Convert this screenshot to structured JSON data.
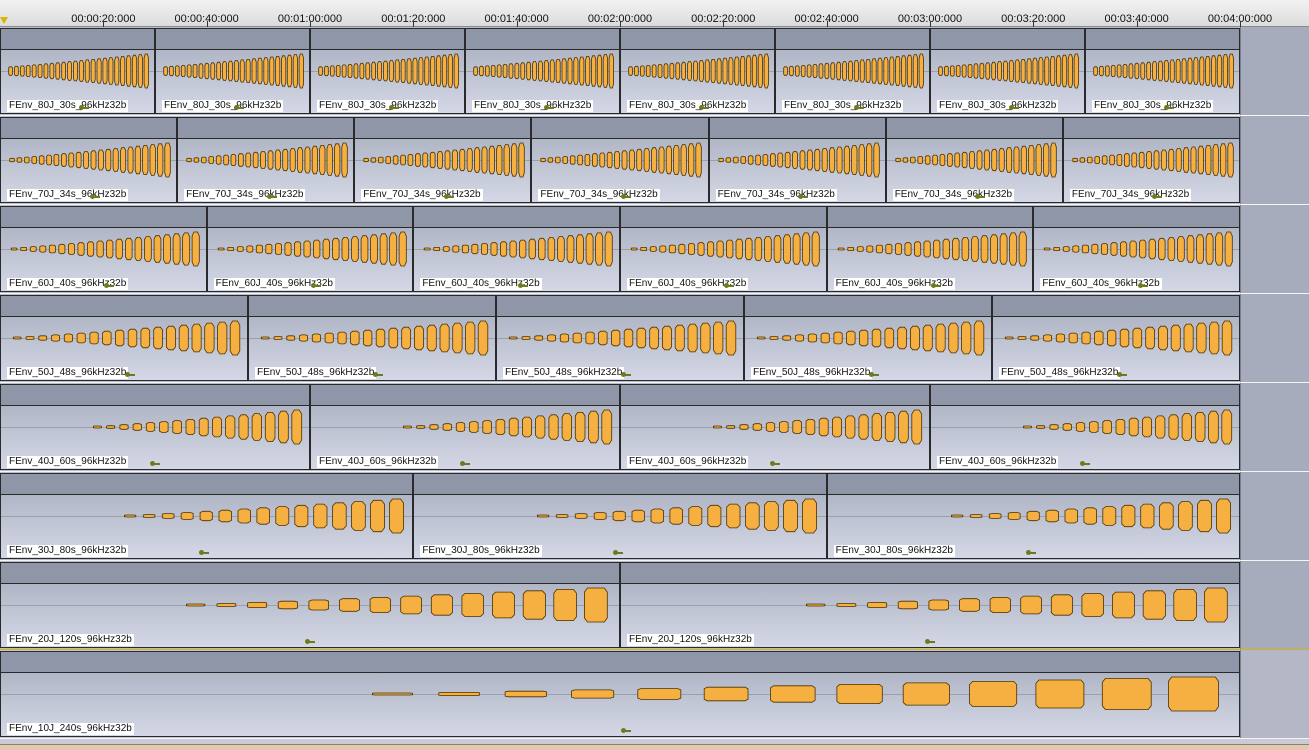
{
  "ruler": {
    "labels": [
      "00:00:20:000",
      "00:00:40:000",
      "00:01:00:000",
      "00:01:20:000",
      "00:01:40:000",
      "00:02:00:000",
      "00:02:20:000",
      "00:02:40:000",
      "00:03:00:000",
      "00:03:20:000",
      "00:03:40:000",
      "00:04:00:000"
    ]
  },
  "tracks": [
    {
      "clip_label": "FEnv_80J_30s_96kHz32b",
      "clip_count": 8,
      "pulses": 24,
      "first_scale": 0.25,
      "min_gap_ratio": 0.25,
      "key_fraction": 0.5
    },
    {
      "clip_label": "FEnv_70J_34s_96kHz32b",
      "clip_count": 7,
      "pulses": 22,
      "first_scale": 0.1,
      "min_gap_ratio": 0.35,
      "key_fraction": 0.5
    },
    {
      "clip_label": "FEnv_60J_40s_96kHz32b",
      "clip_count": 6,
      "pulses": 20,
      "first_scale": 0.06,
      "min_gap_ratio": 0.45,
      "key_fraction": 0.5
    },
    {
      "clip_label": "FEnv_50J_48s_96kHz32b",
      "clip_count": 5,
      "pulses": 18,
      "first_scale": 0.04,
      "min_gap_ratio": 0.55,
      "key_fraction": 0.5
    },
    {
      "clip_label": "FEnv_40J_60s_96kHz32b",
      "clip_count": 4,
      "pulses": 16,
      "first_scale": 0.03,
      "min_gap_ratio": 0.6,
      "key_fraction": 0.48
    },
    {
      "clip_label": "FEnv_30J_80s_96kHz32b",
      "clip_count": 3,
      "pulses": 15,
      "first_scale": 0.03,
      "min_gap_ratio": 0.65,
      "key_fraction": 0.48
    },
    {
      "clip_label": "FEnv_20J_120s_96kHz32b",
      "clip_count": 2,
      "pulses": 14,
      "first_scale": 0.03,
      "min_gap_ratio": 0.7,
      "key_fraction": 0.49
    },
    {
      "clip_label": "FEnv_10J_240s_96kHz32b",
      "clip_count": 1,
      "pulses": 13,
      "first_scale": 0.03,
      "min_gap_ratio": 0.72,
      "key_fraction": 0.5
    }
  ],
  "colors": {
    "waveform_fill": "#f5b041",
    "waveform_stroke": "#4a3100",
    "playhead": "#d9b400"
  }
}
